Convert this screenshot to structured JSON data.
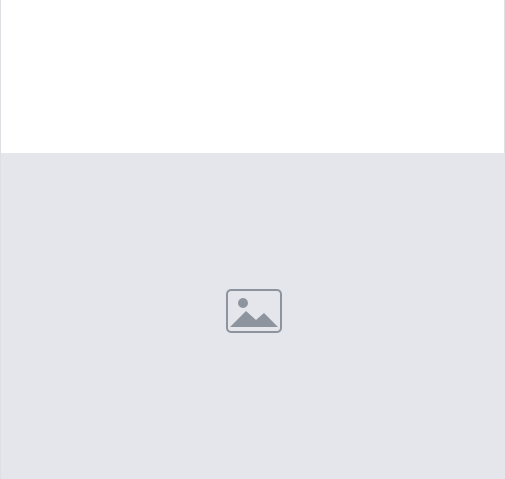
{
  "post": {
    "caption": "",
    "photo": {
      "icon": "image-icon",
      "placeholder_label": ""
    }
  }
}
